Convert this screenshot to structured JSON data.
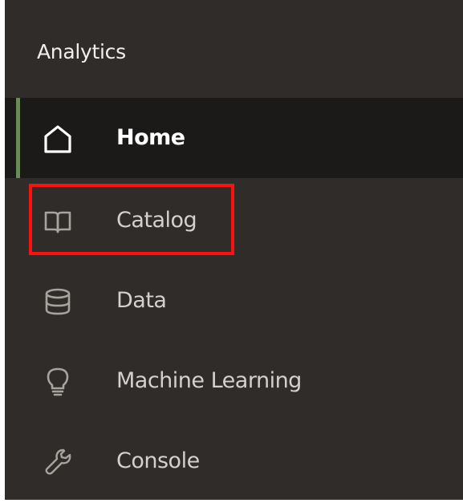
{
  "app": {
    "title": "Analytics"
  },
  "nav": {
    "items": [
      {
        "label": "Home",
        "icon": "home-icon",
        "active": true
      },
      {
        "label": "Catalog",
        "icon": "book-icon",
        "active": false,
        "highlighted": true
      },
      {
        "label": "Data",
        "icon": "database-icon",
        "active": false
      },
      {
        "label": "Machine Learning",
        "icon": "lightbulb-icon",
        "active": false
      },
      {
        "label": "Console",
        "icon": "wrench-icon",
        "active": false
      }
    ]
  },
  "colors": {
    "panel_bg": "#2f2c29",
    "active_bg": "#1c1a18",
    "accent": "#6b8a5a",
    "highlight": "#ff1010",
    "text": "#d4d1cd",
    "text_active": "#ffffff"
  }
}
